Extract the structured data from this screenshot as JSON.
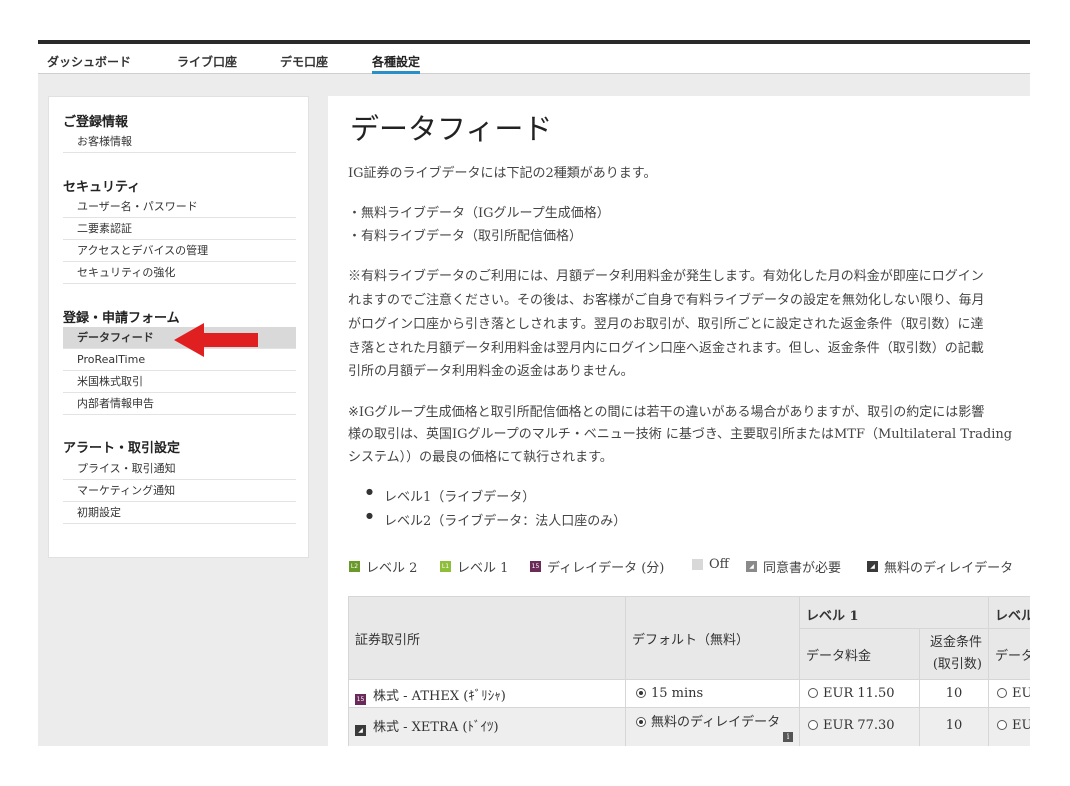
{
  "nav": {
    "tabs": [
      {
        "label": "ダッシュボード"
      },
      {
        "label": "ライブ口座"
      },
      {
        "label": "デモ口座"
      },
      {
        "label": "各種設定"
      }
    ]
  },
  "sidebar": {
    "sections": [
      {
        "title": "ご登録情報",
        "items": [
          "お客様情報"
        ]
      },
      {
        "title": "セキュリティ",
        "items": [
          "ユーザー名・パスワード",
          "二要素認証",
          "アクセスとデバイスの管理",
          "セキュリティの強化"
        ]
      },
      {
        "title": "登録・申請フォーム",
        "items": [
          "データフィード",
          "ProRealTime",
          "米国株式取引",
          "内部者情報申告"
        ]
      },
      {
        "title": "アラート・取引設定",
        "items": [
          "プライス・取引通知",
          "マーケティング通知",
          "初期設定"
        ]
      }
    ]
  },
  "main": {
    "title": "データフィード",
    "intro": "IG証券のライブデータには下記の2種類があります。",
    "types": [
      "・無料ライブデータ（IGグループ生成価格）",
      "・有料ライブデータ（取引所配信価格）"
    ],
    "para1": [
      "※有料ライブデータのご利用には、月額データ利用料金が発生します。有効化した月の料金が即座にログイン",
      "れますのでご注意ください。その後は、お客様がご自身で有料ライブデータの設定を無効化しない限り、毎月",
      "がログイン口座から引き落としされます。翌月のお取引が、取引所ごとに設定された返金条件（取引数）に達",
      "き落とされた月額データ利用料金は翌月内にログイン口座へ返金されます。但し、返金条件（取引数）の記載",
      "引所の月額データ利用料金の返金はありません。"
    ],
    "para2": [
      "※IGグループ生成価格と取引所配信価格との間には若干の違いがある場合がありますが、取引の約定には影響",
      "様の取引は、英国IGグループのマルチ・ベニュー技術 に基づき、主要取引所またはMTF（Multilateral Trading",
      "システム））の最良の価格にて執行されます。"
    ],
    "levels": [
      "レベル1（ライブデータ）",
      "レベル2（ライブデータ：法人口座のみ）"
    ]
  },
  "legend": [
    {
      "code": "L2",
      "label": "レベル 2",
      "color": "#6a9a2a"
    },
    {
      "code": "L1",
      "label": "レベル 1",
      "color": "#8fbf3a"
    },
    {
      "code": "15",
      "label": "ディレイデータ (分)",
      "color": "#6a2a5a"
    },
    {
      "code": "",
      "label": "Off",
      "color": "#cccccc"
    },
    {
      "code": "",
      "label": "同意書が必要",
      "color": "#888888"
    },
    {
      "code": "",
      "label": "無料のディレイデータ",
      "color": "#444444"
    }
  ],
  "table": {
    "col_exchange": "証券取引所",
    "col_default": "デフォルト（無料）",
    "col_level1": "レベル 1",
    "col_level_partial": "レベル",
    "sub_fee": "データ料金",
    "sub_cond_line1": "返金条件",
    "sub_cond_line2": "(取引数)",
    "sub_fee_partial": "データ",
    "rows": [
      {
        "exchange": "株式 - ATHEX (ｷﾞﾘｼｬ)",
        "default": "15 mins",
        "fee": "EUR 11.50",
        "cond": "10",
        "next": "EU"
      },
      {
        "exchange": "株式 - XETRA (ﾄﾞｲﾂ)",
        "default": "無料のディレイデータ",
        "fee": "EUR 77.30",
        "cond": "10",
        "next": "EU"
      }
    ]
  }
}
